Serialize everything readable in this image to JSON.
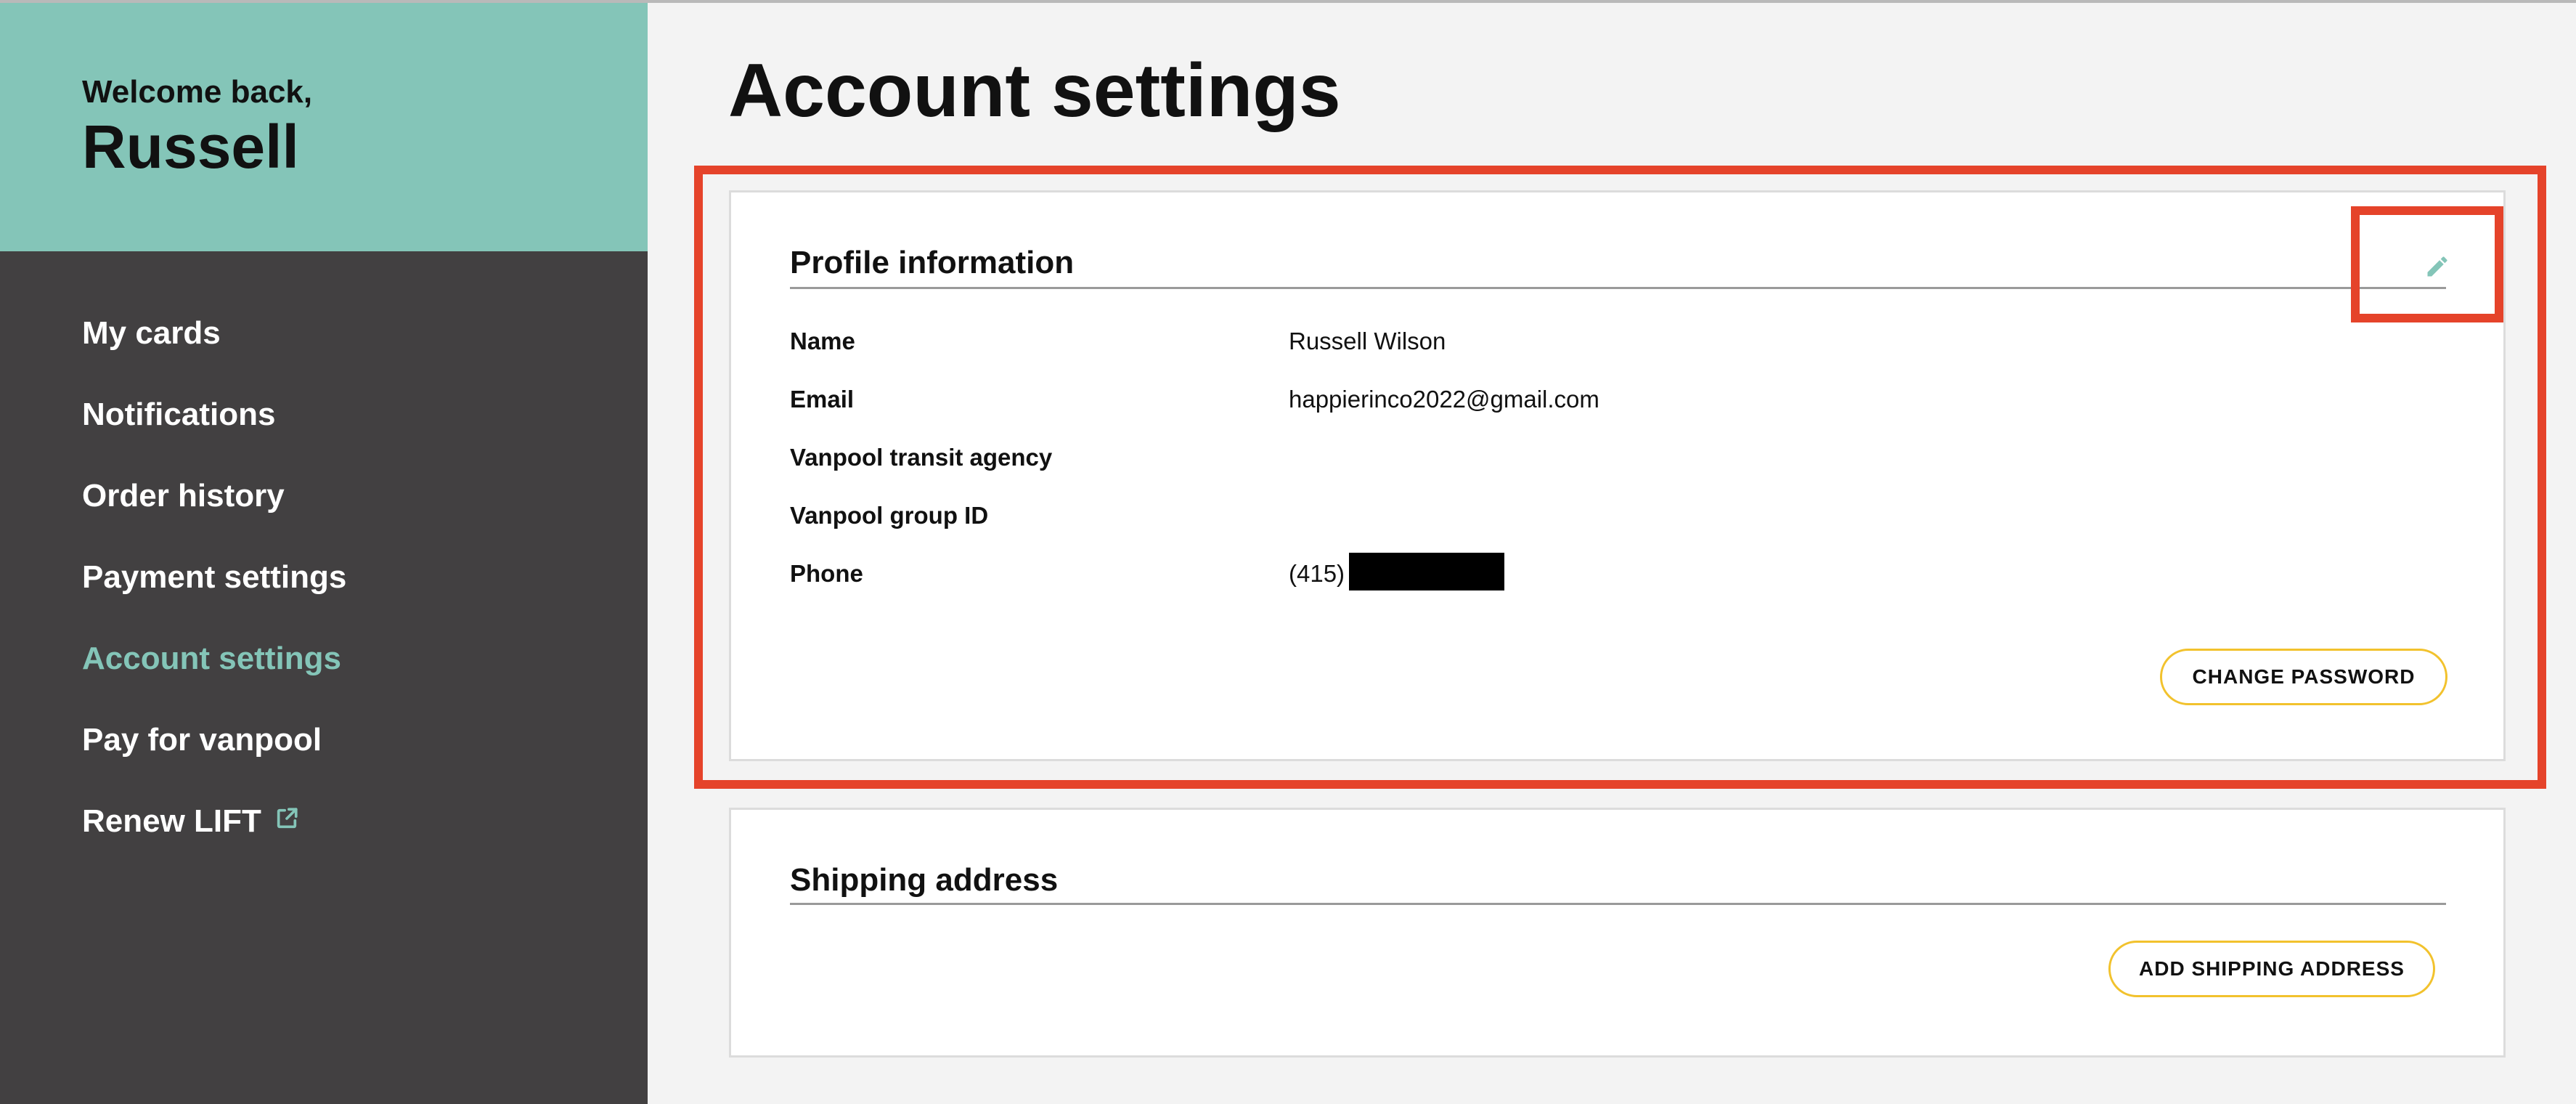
{
  "sidebar": {
    "welcome_line": "Welcome back,",
    "user_name": "Russell",
    "nav": [
      {
        "label": "My cards"
      },
      {
        "label": "Notifications"
      },
      {
        "label": "Order history"
      },
      {
        "label": "Payment settings"
      },
      {
        "label": "Account settings",
        "active": true
      },
      {
        "label": "Pay for vanpool"
      },
      {
        "label": "Renew LIFT",
        "icon": "external-link-icon"
      }
    ]
  },
  "page": {
    "title": "Account settings"
  },
  "profile": {
    "title": "Profile information",
    "edit_icon": "pencil-icon",
    "fields": [
      {
        "label": "Name",
        "value": "Russell Wilson"
      },
      {
        "label": "Email",
        "value": "happierinco2022@gmail.com"
      },
      {
        "label": "Vanpool transit agency",
        "value": ""
      },
      {
        "label": "Vanpool group ID",
        "value": ""
      },
      {
        "label": "Phone",
        "value": "(415)"
      }
    ],
    "change_password_label": "CHANGE PASSWORD"
  },
  "shipping": {
    "title": "Shipping address",
    "add_label": "ADD SHIPPING ADDRESS"
  },
  "colors": {
    "accent_teal": "#84c5b8",
    "sidebar_bg": "#424041",
    "button_border": "#f2c22d",
    "annotation_red": "#e5432a"
  }
}
